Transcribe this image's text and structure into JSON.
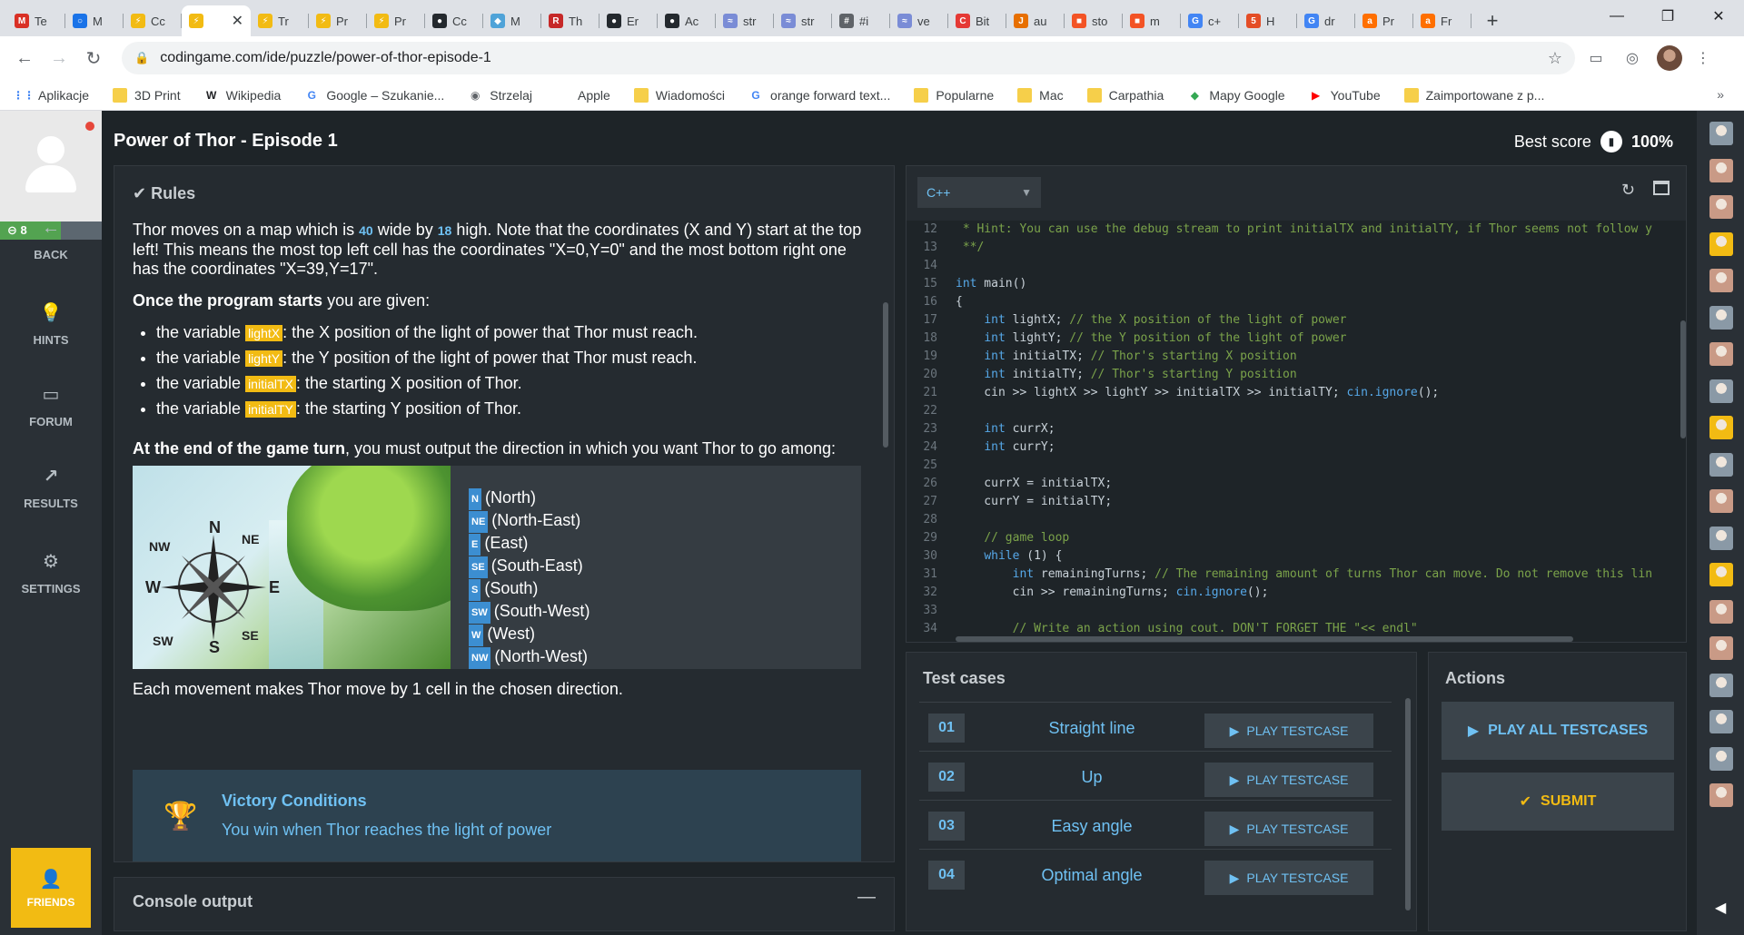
{
  "browser": {
    "tabs": [
      {
        "label": "Te",
        "icon": "gmail-icon",
        "color": "#d93025",
        "glyph": "M"
      },
      {
        "label": "M",
        "icon": "messenger-icon",
        "color": "#1a73e8",
        "glyph": "○"
      },
      {
        "label": "Cc",
        "icon": "codingame-icon",
        "color": "#f2bb13",
        "glyph": "⚡"
      },
      {
        "label": "",
        "icon": "codingame-icon",
        "color": "#f2bb13",
        "glyph": "⚡",
        "active": true
      },
      {
        "label": "Tr",
        "icon": "codingame-icon",
        "color": "#f2bb13",
        "glyph": "⚡"
      },
      {
        "label": "Pr",
        "icon": "codingame-icon",
        "color": "#f2bb13",
        "glyph": "⚡"
      },
      {
        "label": "Pr",
        "icon": "codingame-icon",
        "color": "#f2bb13",
        "glyph": "⚡"
      },
      {
        "label": "Cc",
        "icon": "github-icon",
        "color": "#24292e",
        "glyph": "●"
      },
      {
        "label": "M",
        "icon": "box-icon",
        "color": "#4fa3d8",
        "glyph": "◆"
      },
      {
        "label": "Th",
        "icon": "app-icon",
        "color": "#c62828",
        "glyph": "R"
      },
      {
        "label": "Er",
        "icon": "github-icon",
        "color": "#24292e",
        "glyph": "●"
      },
      {
        "label": "Ac",
        "icon": "github-icon",
        "color": "#24292e",
        "glyph": "●"
      },
      {
        "label": "str",
        "icon": "stackblitz-icon",
        "color": "#7a8cd6",
        "glyph": "≈"
      },
      {
        "label": "str",
        "icon": "stackblitz-icon",
        "color": "#7a8cd6",
        "glyph": "≈"
      },
      {
        "label": "#i",
        "icon": "page-icon",
        "color": "#5f6368",
        "glyph": "#"
      },
      {
        "label": "ve",
        "icon": "stackblitz-icon",
        "color": "#7a8cd6",
        "glyph": "≈"
      },
      {
        "label": "Bit",
        "icon": "cpp-icon",
        "color": "#e53935",
        "glyph": "C"
      },
      {
        "label": "au",
        "icon": "java-icon",
        "color": "#e76f00",
        "glyph": "J"
      },
      {
        "label": "sto",
        "icon": "microsoft-icon",
        "color": "#f35325",
        "glyph": "■"
      },
      {
        "label": "m",
        "icon": "microsoft-icon",
        "color": "#f35325",
        "glyph": "■"
      },
      {
        "label": "c+",
        "icon": "google-icon",
        "color": "#4285f4",
        "glyph": "G"
      },
      {
        "label": "H",
        "icon": "html-icon",
        "color": "#e44d26",
        "glyph": "5"
      },
      {
        "label": "dr",
        "icon": "google-icon",
        "color": "#4285f4",
        "glyph": "G"
      },
      {
        "label": "Pr",
        "icon": "amazon-icon",
        "color": "#ff6f00",
        "glyph": "a"
      },
      {
        "label": "Fr",
        "icon": "amazon-icon",
        "color": "#ff6f00",
        "glyph": "a"
      }
    ],
    "url": "codingame.com/ide/puzzle/power-of-thor-episode-1",
    "bookmarks": [
      {
        "label": "Aplikacje",
        "icon": "apps-grid-icon",
        "glyph": "⋮⋮",
        "color": "#4285f4"
      },
      {
        "label": "3D Print",
        "icon": "folder-icon",
        "glyph": "",
        "color": "#f6cf4a"
      },
      {
        "label": "Wikipedia",
        "icon": "wikipedia-icon",
        "glyph": "W",
        "color": "#202124"
      },
      {
        "label": "Google – Szukanie...",
        "icon": "google-icon",
        "glyph": "G",
        "color": "#4285f4"
      },
      {
        "label": "Strzelaj",
        "icon": "globe-icon",
        "glyph": "◉",
        "color": "#5f6368"
      },
      {
        "label": "Apple",
        "icon": "apple-icon",
        "glyph": "",
        "color": "#5f6368"
      },
      {
        "label": "Wiadomości",
        "icon": "folder-icon",
        "glyph": "",
        "color": "#f6cf4a"
      },
      {
        "label": "orange forward text...",
        "icon": "google-icon",
        "glyph": "G",
        "color": "#4285f4"
      },
      {
        "label": "Popularne",
        "icon": "folder-icon",
        "glyph": "",
        "color": "#f6cf4a"
      },
      {
        "label": "Mac",
        "icon": "folder-icon",
        "glyph": "",
        "color": "#f6cf4a"
      },
      {
        "label": "Carpathia",
        "icon": "folder-icon",
        "glyph": "",
        "color": "#f6cf4a"
      },
      {
        "label": "Mapy Google",
        "icon": "google-maps-icon",
        "glyph": "◆",
        "color": "#34a853"
      },
      {
        "label": "YouTube",
        "icon": "youtube-icon",
        "glyph": "▶",
        "color": "#ff0000"
      },
      {
        "label": "Zaimportowane z p...",
        "icon": "folder-icon",
        "glyph": "",
        "color": "#f6cf4a"
      }
    ]
  },
  "sidebar": {
    "level": "8",
    "level_progress": 0.6,
    "items": [
      {
        "label": "BACK",
        "icon": "arrow-left-icon",
        "glyph": "←"
      },
      {
        "label": "HINTS",
        "icon": "lightbulb-icon",
        "glyph": "●"
      },
      {
        "label": "FORUM",
        "icon": "forum-icon",
        "glyph": "▭"
      },
      {
        "label": "RESULTS",
        "icon": "chart-line-icon",
        "glyph": "↗"
      },
      {
        "label": "SETTINGS",
        "icon": "gear-icon",
        "glyph": "⚙"
      }
    ],
    "friends_label": "FRIENDS"
  },
  "header": {
    "title": "Power of Thor - Episode 1",
    "best_score_label": "Best score",
    "best_score_value": "100%"
  },
  "statement": {
    "rules_label": "Rules",
    "p1": {
      "a": "Thor moves on a map which is ",
      "width": "40",
      "b": " wide by ",
      "height": "18",
      "c": " high. Note that the coordinates (X and Y) start at the top left! This means the most top left cell has the coordinates \"X=0,Y=0\" and the most bottom right one has the coordinates \"X=39,Y=17\"."
    },
    "p2": {
      "bold": "Once the program starts",
      "rest": " you are given:"
    },
    "vars": [
      {
        "pre": "the variable ",
        "name": "lightX",
        "post": ": the X position of the light of power that Thor must reach."
      },
      {
        "pre": "the variable ",
        "name": "lightY",
        "post": ": the Y position of the light of power that Thor must reach."
      },
      {
        "pre": "the variable ",
        "name": "initialTX",
        "post": ": the starting X position of Thor."
      },
      {
        "pre": "the variable ",
        "name": "initialTY",
        "post": ": the starting Y position of Thor."
      }
    ],
    "p3": {
      "bold": "At the end of the game turn",
      "rest": ", you must output the direction in which you want Thor to go among:"
    },
    "compass_labels": {
      "n": "N",
      "ne": "NE",
      "e": "E",
      "se": "SE",
      "s": "S",
      "sw": "SW",
      "w": "W",
      "nw": "NW"
    },
    "directions": [
      {
        "code": "N",
        "name": "(North)"
      },
      {
        "code": "NE",
        "name": "(North-East)"
      },
      {
        "code": "E",
        "name": "(East)"
      },
      {
        "code": "SE",
        "name": "(South-East)"
      },
      {
        "code": "S",
        "name": "(South)"
      },
      {
        "code": "SW",
        "name": "(South-West)"
      },
      {
        "code": "W",
        "name": "(West)"
      },
      {
        "code": "NW",
        "name": "(North-West)"
      }
    ],
    "p4": "Each movement makes Thor move by 1 cell in the chosen direction.",
    "victory_title": "Victory Conditions",
    "victory_text": "You win when Thor reaches the light of power"
  },
  "console": {
    "title": "Console output",
    "min_label": "—"
  },
  "editor": {
    "language": "C++",
    "lines": [
      {
        "n": "12",
        "parts": [
          {
            "t": " * Hint: You can use the debug stream to print initialTX and initialTY, if Thor seems not follow y",
            "c": "cm"
          }
        ]
      },
      {
        "n": "13",
        "parts": [
          {
            "t": " **/",
            "c": "cm"
          }
        ]
      },
      {
        "n": "14",
        "parts": []
      },
      {
        "n": "15",
        "parts": [
          {
            "t": "int",
            "c": "kw"
          },
          {
            "t": " main()",
            "c": "ct"
          }
        ]
      },
      {
        "n": "16",
        "parts": [
          {
            "t": "{",
            "c": "ct"
          }
        ]
      },
      {
        "n": "17",
        "parts": [
          {
            "t": "    ",
            "c": "ct"
          },
          {
            "t": "int",
            "c": "kw"
          },
          {
            "t": " lightX; ",
            "c": "ct"
          },
          {
            "t": "// the X position of the light of power",
            "c": "cm"
          }
        ]
      },
      {
        "n": "18",
        "parts": [
          {
            "t": "    ",
            "c": "ct"
          },
          {
            "t": "int",
            "c": "kw"
          },
          {
            "t": " lightY; ",
            "c": "ct"
          },
          {
            "t": "// the Y position of the light of power",
            "c": "cm"
          }
        ]
      },
      {
        "n": "19",
        "parts": [
          {
            "t": "    ",
            "c": "ct"
          },
          {
            "t": "int",
            "c": "kw"
          },
          {
            "t": " initialTX; ",
            "c": "ct"
          },
          {
            "t": "// Thor's starting X position",
            "c": "cm"
          }
        ]
      },
      {
        "n": "20",
        "parts": [
          {
            "t": "    ",
            "c": "ct"
          },
          {
            "t": "int",
            "c": "kw"
          },
          {
            "t": " initialTY; ",
            "c": "ct"
          },
          {
            "t": "// Thor's starting Y position",
            "c": "cm"
          }
        ]
      },
      {
        "n": "21",
        "parts": [
          {
            "t": "    cin >> lightX >> lightY >> initialTX >> initialTY; ",
            "c": "ct"
          },
          {
            "t": "cin.ignore",
            "c": "kw"
          },
          {
            "t": "();",
            "c": "ct"
          }
        ]
      },
      {
        "n": "22",
        "parts": []
      },
      {
        "n": "23",
        "parts": [
          {
            "t": "    ",
            "c": "ct"
          },
          {
            "t": "int",
            "c": "kw"
          },
          {
            "t": " currX;",
            "c": "ct"
          }
        ]
      },
      {
        "n": "24",
        "parts": [
          {
            "t": "    ",
            "c": "ct"
          },
          {
            "t": "int",
            "c": "kw"
          },
          {
            "t": " currY;",
            "c": "ct"
          }
        ]
      },
      {
        "n": "25",
        "parts": []
      },
      {
        "n": "26",
        "parts": [
          {
            "t": "    currX = initialTX;",
            "c": "ct"
          }
        ]
      },
      {
        "n": "27",
        "parts": [
          {
            "t": "    currY = initialTY;",
            "c": "ct"
          }
        ]
      },
      {
        "n": "28",
        "parts": []
      },
      {
        "n": "29",
        "parts": [
          {
            "t": "    ",
            "c": "ct"
          },
          {
            "t": "// game loop",
            "c": "cm"
          }
        ]
      },
      {
        "n": "30",
        "parts": [
          {
            "t": "    ",
            "c": "ct"
          },
          {
            "t": "while",
            "c": "kw"
          },
          {
            "t": " (1) {",
            "c": "ct"
          }
        ]
      },
      {
        "n": "31",
        "parts": [
          {
            "t": "        ",
            "c": "ct"
          },
          {
            "t": "int",
            "c": "kw"
          },
          {
            "t": " remainingTurns; ",
            "c": "ct"
          },
          {
            "t": "// The remaining amount of turns Thor can move. Do not remove this lin",
            "c": "cm"
          }
        ]
      },
      {
        "n": "32",
        "parts": [
          {
            "t": "        cin >> remainingTurns; ",
            "c": "ct"
          },
          {
            "t": "cin.ignore",
            "c": "kw"
          },
          {
            "t": "();",
            "c": "ct"
          }
        ]
      },
      {
        "n": "33",
        "parts": []
      },
      {
        "n": "34",
        "parts": [
          {
            "t": "        ",
            "c": "ct"
          },
          {
            "t": "// Write an action using cout. DON'T FORGET THE \"<< endl\"",
            "c": "cm"
          }
        ]
      }
    ]
  },
  "testcases": {
    "title": "Test cases",
    "play_label": "PLAY TESTCASE",
    "items": [
      {
        "num": "01",
        "name": "Straight line"
      },
      {
        "num": "02",
        "name": "Up"
      },
      {
        "num": "03",
        "name": "Easy angle"
      },
      {
        "num": "04",
        "name": "Optimal angle"
      }
    ]
  },
  "actions": {
    "title": "Actions",
    "play_all_label": "PLAY ALL TESTCASES",
    "submit_label": "SUBMIT"
  },
  "dock": {
    "icons": [
      {
        "icon": "bot-avatar-icon",
        "color": "#8a99a6"
      },
      {
        "icon": "user-avatar-icon",
        "color": "#c99a86"
      },
      {
        "icon": "user-avatar-icon",
        "color": "#c99a86"
      },
      {
        "icon": "rocket-avatar-icon",
        "color": "#f2bb13"
      },
      {
        "icon": "user-avatar-icon",
        "color": "#c99a86"
      },
      {
        "icon": "bot-avatar-icon",
        "color": "#8a99a6"
      },
      {
        "icon": "user-avatar-icon",
        "color": "#c99a86"
      },
      {
        "icon": "bot-avatar-icon",
        "color": "#8a99a6"
      },
      {
        "icon": "rocket-avatar-icon",
        "color": "#f2bb13"
      },
      {
        "icon": "bot-avatar-icon",
        "color": "#8a99a6"
      },
      {
        "icon": "user-avatar-icon",
        "color": "#c99a86"
      },
      {
        "icon": "bot-avatar-icon",
        "color": "#8a99a6"
      },
      {
        "icon": "rocket-avatar-icon",
        "color": "#f2bb13"
      },
      {
        "icon": "user-avatar-icon",
        "color": "#c99a86"
      },
      {
        "icon": "user-avatar-icon",
        "color": "#c99a86"
      },
      {
        "icon": "bot-avatar-icon",
        "color": "#8a99a6"
      },
      {
        "icon": "bot-avatar-icon",
        "color": "#8a99a6"
      },
      {
        "icon": "bot-avatar-icon",
        "color": "#8a99a6"
      },
      {
        "icon": "user-avatar-icon",
        "color": "#c99a86"
      }
    ]
  }
}
